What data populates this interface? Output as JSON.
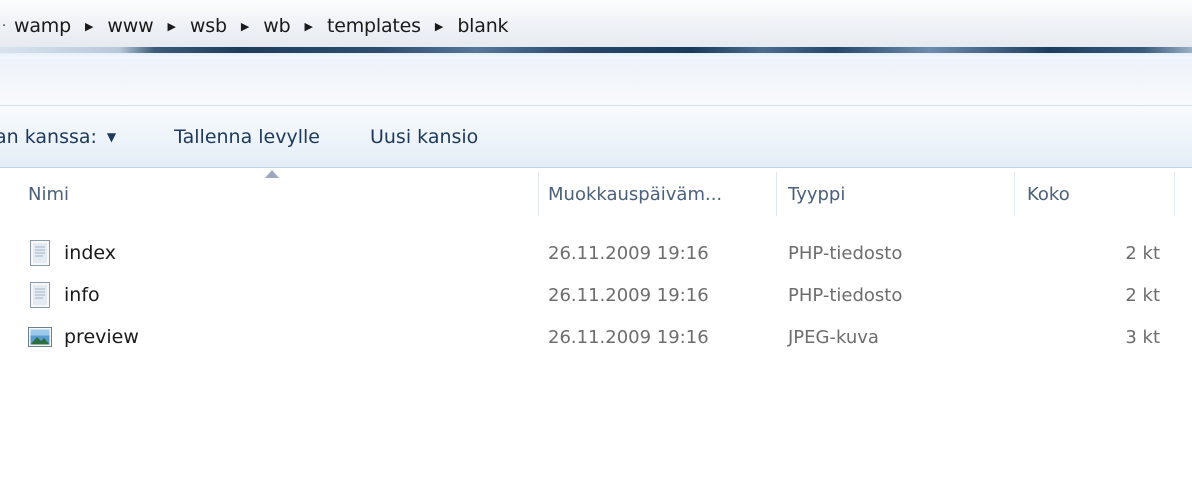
{
  "breadcrumb": {
    "lead": "·",
    "items": [
      {
        "label": "wamp"
      },
      {
        "label": "www"
      },
      {
        "label": "wsb"
      },
      {
        "label": "wb"
      },
      {
        "label": "templates"
      },
      {
        "label": "blank"
      }
    ]
  },
  "toolbar": {
    "share_label": "an kanssa:",
    "burn_label": "Tallenna levylle",
    "new_folder_label": "Uusi kansio"
  },
  "columns": {
    "name": "Nimi",
    "date": "Muokkauspäiväm...",
    "type": "Tyyppi",
    "size": "Koko"
  },
  "files": [
    {
      "name": "index",
      "date": "26.11.2009 19:16",
      "type": "PHP-tiedosto",
      "size": "2 kt",
      "icon": "php-file-icon"
    },
    {
      "name": "info",
      "date": "26.11.2009 19:16",
      "type": "PHP-tiedosto",
      "size": "2 kt",
      "icon": "php-file-icon"
    },
    {
      "name": "preview",
      "date": "26.11.2009 19:16",
      "type": "JPEG-kuva",
      "size": "3 kt",
      "icon": "jpeg-image-icon"
    }
  ]
}
